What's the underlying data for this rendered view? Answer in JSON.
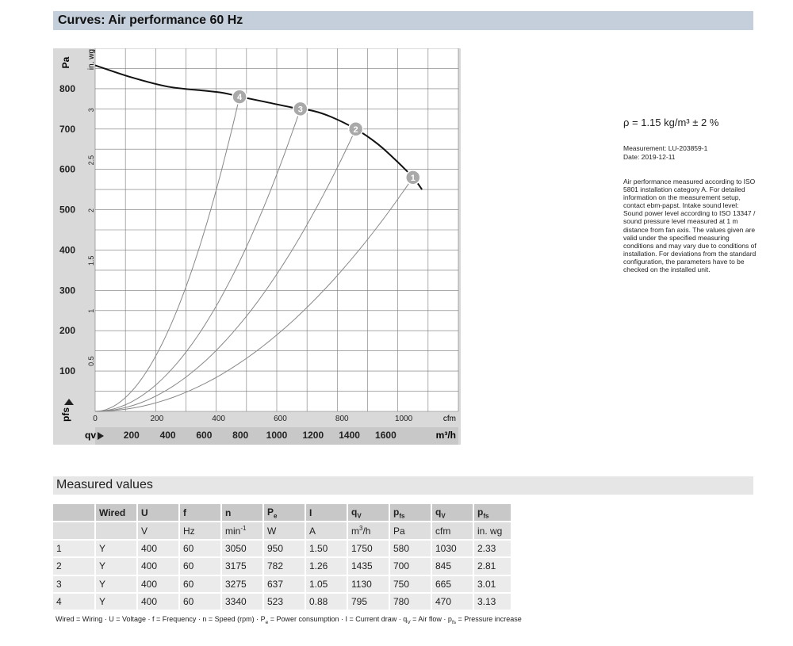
{
  "header": {
    "title": "Curves: Air performance 60 Hz"
  },
  "chart_data": {
    "type": "line",
    "title": "Curves: Air performance 60 Hz",
    "y_unit_left": "Pa",
    "y_unit_right": "in. wg",
    "y_symbol": "pfs",
    "x_symbol": "qv",
    "x_unit_bottom": "m³/h",
    "x_unit_top": "cfm",
    "ylim": [
      0,
      900
    ],
    "xlim": [
      0,
      2000
    ],
    "grid": true,
    "y_ticks_pa": [
      "100",
      "200",
      "300",
      "400",
      "500",
      "600",
      "700",
      "800"
    ],
    "y_ticks_inwg": [
      "0.5",
      "1",
      "1.5",
      "2",
      "2.5",
      "3"
    ],
    "x_ticks_m3h": [
      "200",
      "400",
      "600",
      "800",
      "1000",
      "1200",
      "1400",
      "1600"
    ],
    "x_ticks_cfm": [
      "0",
      "200",
      "400",
      "600",
      "800",
      "1000"
    ],
    "fan_curve": {
      "x": [
        0,
        200,
        400,
        600,
        700,
        800,
        950,
        1100,
        1200,
        1300,
        1435,
        1550,
        1650,
        1750,
        1800
      ],
      "y": [
        858,
        828,
        805,
        795,
        790,
        780,
        766,
        752,
        745,
        730,
        700,
        665,
        625,
        580,
        550
      ]
    },
    "operating_points": [
      {
        "label": "1",
        "x": 1750,
        "y": 580
      },
      {
        "label": "2",
        "x": 1435,
        "y": 700
      },
      {
        "label": "3",
        "x": 1130,
        "y": 750
      },
      {
        "label": "4",
        "x": 795,
        "y": 780
      }
    ]
  },
  "info": {
    "density": "ρ = 1.15 kg/m³ ± 2 %",
    "measurement": "Measurement: LU-203859-1",
    "date": "Date: 2019-12-11",
    "note_lines": [
      "Air performance measured according to ISO",
      "5801 installation category A. For detailed",
      "information on the measurement setup,",
      "contact ebm-papst. Intake sound level:",
      "Sound power level according to ISO 13347 /",
      "sound pressure level measured at 1 m",
      "distance from fan axis. The values given are",
      "valid under the specified measuring",
      "conditions and may vary due to conditions of",
      "installation. For deviations from the standard",
      "configuration, the parameters have to be",
      "checked on the installed unit."
    ]
  },
  "measured": {
    "title": "Measured values",
    "headers": [
      "",
      "Wired",
      "U",
      "f",
      "n",
      "Pe",
      "I",
      "qV",
      "pfs",
      "qV",
      "pfs"
    ],
    "units": [
      "",
      "",
      "V",
      "Hz",
      "min-1",
      "W",
      "A",
      "m3/h",
      "Pa",
      "cfm",
      "in. wg"
    ],
    "rows": [
      [
        "1",
        "Y",
        "400",
        "60",
        "3050",
        "950",
        "1.50",
        "1750",
        "580",
        "1030",
        "2.33"
      ],
      [
        "2",
        "Y",
        "400",
        "60",
        "3175",
        "782",
        "1.26",
        "1435",
        "700",
        "845",
        "2.81"
      ],
      [
        "3",
        "Y",
        "400",
        "60",
        "3275",
        "637",
        "1.05",
        "1130",
        "750",
        "665",
        "3.01"
      ],
      [
        "4",
        "Y",
        "400",
        "60",
        "3340",
        "523",
        "0.88",
        "795",
        "780",
        "470",
        "3.13"
      ]
    ],
    "legend": "Wired = Wiring · U = Voltage · f = Frequency · n = Speed (rpm) · Pe = Power consumption · I = Current draw · qV = Air flow · pfs = Pressure increase"
  }
}
